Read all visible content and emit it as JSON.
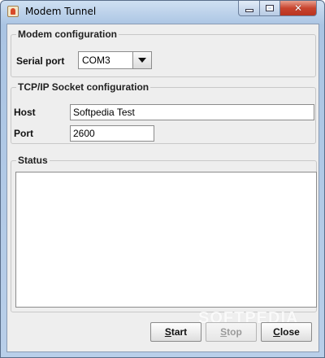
{
  "window": {
    "title": "Modem Tunnel"
  },
  "modem": {
    "group_label": "Modem configuration",
    "serial_port_label": "Serial port",
    "serial_port_value": "COM3"
  },
  "tcpip": {
    "group_label": "TCP/IP Socket configuration",
    "host_label": "Host",
    "host_value": "Softpedia Test",
    "port_label": "Port",
    "port_value": "2600"
  },
  "status": {
    "group_label": "Status",
    "text": ""
  },
  "buttons": {
    "start_mnemonic": "S",
    "start_rest": "tart",
    "stop_mnemonic": "S",
    "stop_rest": "top",
    "close_mnemonic": "C",
    "close_rest": "lose",
    "stop_enabled": false
  },
  "watermark": "SOFTPEDIA",
  "icons": {
    "app": "java-cup-icon",
    "minimize": "minimize-icon",
    "maximize": "maximize-icon",
    "close": "close-icon",
    "dropdown": "chevron-down-icon"
  },
  "colors": {
    "close_button": "#c8452f",
    "panel_background": "#eeeeee"
  }
}
